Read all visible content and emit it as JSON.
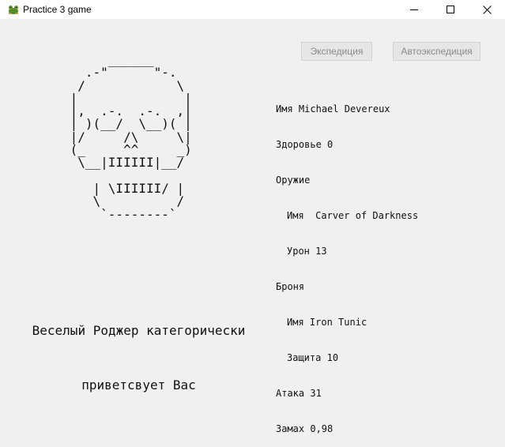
{
  "window": {
    "title": "Practice 3 game",
    "icon": "frog-icon",
    "controls": [
      "minimize-icon",
      "maximize-icon",
      "close-icon"
    ]
  },
  "buttons": {
    "expedition": "Экспедиция",
    "auto_expedition": "Автоэкспедиция",
    "state": "disabled"
  },
  "ascii_art": "      ______\n   .-\"      \"-.\n  /            \\\n |              |\n |,  .-.  .-.  ,|\n | )(__/  \\__)( |\n |/     /\\     \\|\n (_     ^^     _)\n  \\__|IIIIII|__/\n\n    | \\IIIIII/ |\n    \\          /\n     `--------`",
  "caption": {
    "line1": "Веселый Роджер категорически",
    "line2": "приветсвует Вас"
  },
  "character": {
    "name_label": "Имя",
    "name": "Michael Devereux",
    "health_label": "Здоровье",
    "health": "0",
    "weapon_label": "Оружие",
    "weapon": {
      "name_label": "Имя",
      "name": "Carver of Darkness",
      "damage_label": "Урон",
      "damage": "13"
    },
    "armor_label": "Броня",
    "armor": {
      "name_label": "Имя",
      "name": "Iron Tunic",
      "defense_label": "Защита",
      "defense": "10"
    },
    "attack_label": "Атака",
    "attack": "31",
    "swing_label": "Замах",
    "swing": "0,98"
  }
}
